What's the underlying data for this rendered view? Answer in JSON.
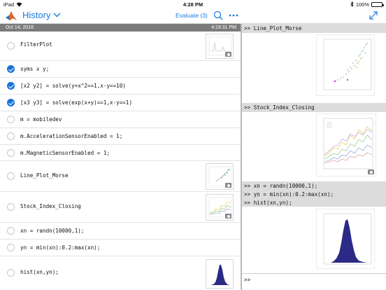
{
  "status_bar": {
    "device": "iPad",
    "time": "4:28 PM",
    "battery": "100%"
  },
  "nav": {
    "title": "History",
    "evaluate_label": "Evaluate (3)"
  },
  "history": {
    "date": "Oct 14, 2016",
    "time": "4:19:31 PM",
    "items": [
      {
        "command": "FilterPlot",
        "checked": false
      },
      {
        "command": "syms x y;",
        "checked": true
      },
      {
        "command": "[x2 y2] = solve(y+x^2==1,x-y==10)",
        "checked": true
      },
      {
        "command": "[x3 y3] = solve(exp(x+y)==1,x-y==1)",
        "checked": true
      },
      {
        "command": "m = mobiledev",
        "checked": false
      },
      {
        "command": "m.AccelerationSensorEnabled = 1;",
        "checked": false
      },
      {
        "command": "m.MagneticSensorEnabled = 1;",
        "checked": false
      },
      {
        "command": "Line_Plot_Morse",
        "checked": false
      },
      {
        "command": "Stock_Index_Closing",
        "checked": false
      },
      {
        "command": "xn = randn(10000,1);",
        "checked": false
      },
      {
        "command": "yn = min(xn):0.2:max(xn);",
        "checked": false
      },
      {
        "command": "hist(xn,yn);",
        "checked": false
      }
    ]
  },
  "command_window": {
    "entries": [
      ">> Line_Plot_Morse",
      ">> Stock_Index_Closing",
      ">> xn = randn(10000,1);",
      ">> yn = min(xn):0.2:max(xn);",
      ">> hist(xn,yn);"
    ],
    "prompt": ">>"
  },
  "colors": {
    "accent": "#1f7ae0",
    "check": "#1a73d9",
    "histogram": "#2b2a86",
    "date_bar": "#7b7b7b"
  },
  "icons": {
    "logo": "matlab-logo-icon",
    "title_chevron": "chevron-down-icon",
    "search": "search-icon",
    "more": "more-icon",
    "expand": "expand-icon",
    "camera": "camera-icon",
    "wifi": "wifi-icon",
    "bluetooth": "bluetooth-icon"
  }
}
